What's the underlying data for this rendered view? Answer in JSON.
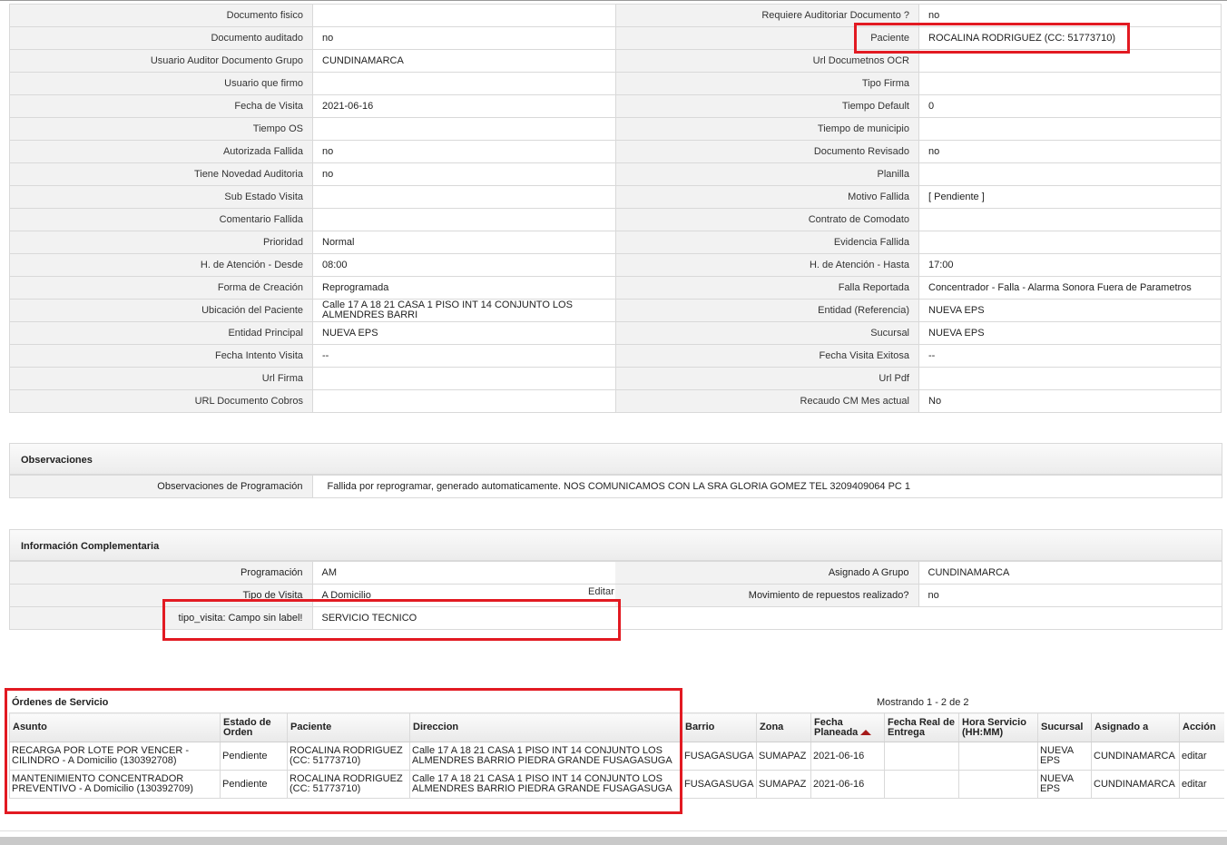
{
  "details": [
    [
      "Documento fisico",
      "",
      "Requiere Auditoriar Documento ?",
      "no"
    ],
    [
      "Documento auditado",
      "no",
      "Paciente",
      "ROCALINA RODRIGUEZ (CC: 51773710)"
    ],
    [
      "Usuario Auditor Documento Grupo",
      "CUNDINAMARCA",
      "Url Documetnos OCR",
      ""
    ],
    [
      "Usuario que firmo",
      "",
      "Tipo Firma",
      ""
    ],
    [
      "Fecha de Visita",
      "2021-06-16",
      "Tiempo Default",
      "0"
    ],
    [
      "Tiempo OS",
      "",
      "Tiempo de municipio",
      ""
    ],
    [
      "Autorizada Fallida",
      "no",
      "Documento Revisado",
      "no"
    ],
    [
      "Tiene Novedad Auditoria",
      "no",
      "Planilla",
      ""
    ],
    [
      "Sub Estado Visita",
      "",
      "Motivo Fallida",
      "[ Pendiente ]"
    ],
    [
      "Comentario Fallida",
      "",
      "Contrato de Comodato",
      ""
    ],
    [
      "Prioridad",
      "Normal",
      "Evidencia Fallida",
      ""
    ],
    [
      "H. de Atención - Desde",
      "08:00",
      "H. de Atención - Hasta",
      "17:00"
    ],
    [
      "Forma de Creación",
      "Reprogramada",
      "Falla Reportada",
      "Concentrador - Falla - Alarma Sonora Fuera de Parametros"
    ],
    [
      "Ubicación del Paciente",
      "Calle 17 A 18 21 CASA 1 PISO INT 14 CONJUNTO LOS ALMENDRES BARRI",
      "Entidad (Referencia)",
      "NUEVA EPS"
    ],
    [
      "Entidad Principal",
      "NUEVA EPS",
      "Sucursal",
      "NUEVA EPS"
    ],
    [
      "Fecha Intento Visita",
      "--",
      "Fecha Visita Exitosa",
      "--"
    ],
    [
      "Url Firma",
      "",
      "Url Pdf",
      ""
    ],
    [
      "URL Documento Cobros",
      "",
      "Recaudo CM Mes actual",
      "No"
    ]
  ],
  "observaciones": {
    "title": "Observaciones",
    "label": "Observaciones de Programación",
    "value": "Fallida por reprogramar, generado automaticamente. NOS COMUNICAMOS CON LA SRA GLORIA GOMEZ TEL 3209409064 PC 1"
  },
  "complementaria": {
    "title": "Información Complementaria",
    "rows": [
      [
        "Programación",
        "AM",
        "Asignado A Grupo",
        "CUNDINAMARCA"
      ],
      [
        "Tipo de Visita",
        "A Domicilio",
        "Movimiento de repuestos realizado?",
        "no"
      ],
      [
        "tipo_visita: Campo sin label!",
        "SERVICIO TECNICO",
        "",
        ""
      ]
    ],
    "edit_label": "Editar"
  },
  "orders": {
    "title": "Órdenes de Servicio",
    "showing": "Mostrando 1 - 2 de 2",
    "columns": [
      "Asunto",
      "Estado de Orden",
      "Paciente",
      "Direccion",
      "Barrio",
      "Zona",
      "Fecha Planeada",
      "Fecha Real de Entrega",
      "Hora Servicio (HH:MM)",
      "Sucursal",
      "Asignado a",
      "Acción"
    ],
    "rows": [
      [
        "RECARGA POR LOTE POR VENCER - CILINDRO - A Domicilio (130392708)",
        "Pendiente",
        "ROCALINA RODRIGUEZ (CC: 51773710)",
        "Calle 17 A 18 21 CASA 1 PISO INT 14 CONJUNTO LOS ALMENDRES BARRIO PIEDRA GRANDE FUSAGASUGA",
        "FUSAGASUGA",
        "SUMAPAZ",
        "2021-06-16",
        "",
        "",
        "NUEVA EPS",
        "CUNDINAMARCA",
        "editar"
      ],
      [
        "MANTENIMIENTO CONCENTRADOR PREVENTIVO - A Domicilio (130392709)",
        "Pendiente",
        "ROCALINA RODRIGUEZ (CC: 51773710)",
        "Calle 17 A 18 21 CASA 1 PISO INT 14 CONJUNTO LOS ALMENDRES BARRIO PIEDRA GRANDE FUSAGASUGA",
        "FUSAGASUGA",
        "SUMAPAZ",
        "2021-06-16",
        "",
        "",
        "NUEVA EPS",
        "CUNDINAMARCA",
        "editar"
      ]
    ]
  },
  "colors": {
    "highlight": "#e21a22",
    "label_bg": "#f2f2f2",
    "border": "#d9d9d9",
    "sort_arrow": "#a51a1a"
  }
}
